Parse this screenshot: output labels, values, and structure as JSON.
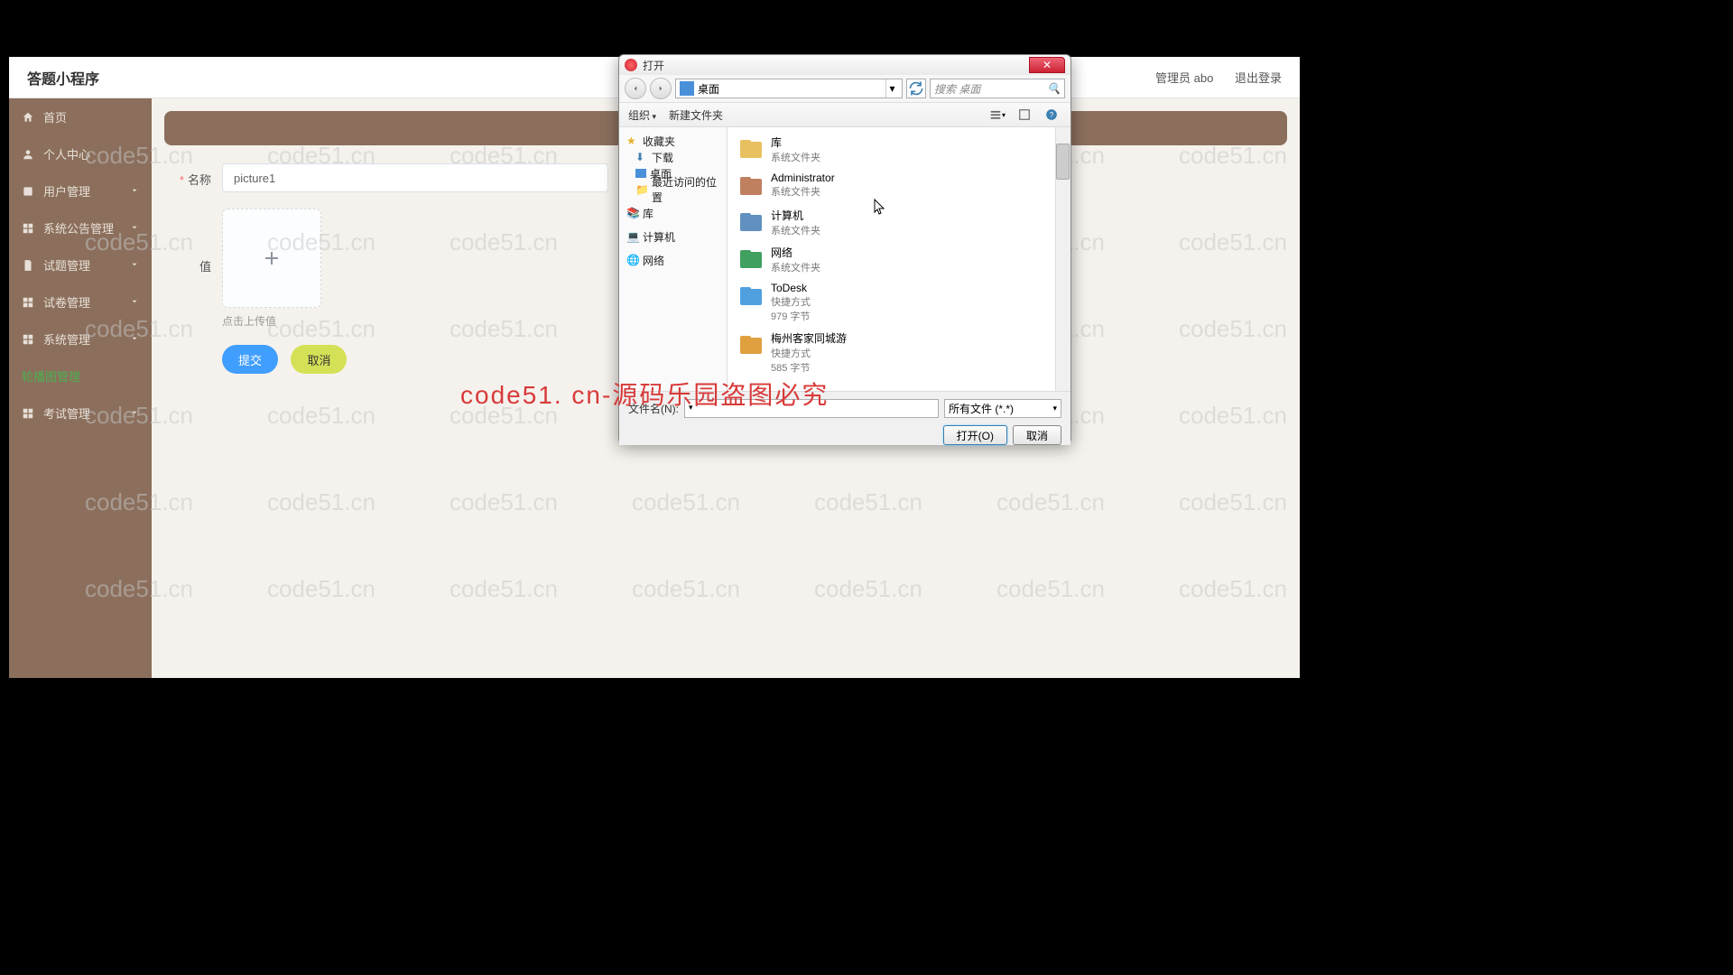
{
  "app": {
    "title": "答题小程序"
  },
  "header": {
    "admin": "管理员 abo",
    "logout": "退出登录"
  },
  "sidebar": {
    "items": [
      {
        "label": "首页",
        "icon": "home"
      },
      {
        "label": "个人中心",
        "icon": "user"
      },
      {
        "label": "用户管理",
        "icon": "users",
        "chevron": true
      },
      {
        "label": "系统公告管理",
        "icon": "grid",
        "chevron": true
      },
      {
        "label": "试题管理",
        "icon": "doc",
        "chevron": true
      },
      {
        "label": "试卷管理",
        "icon": "grid",
        "chevron": true
      },
      {
        "label": "系统管理",
        "icon": "grid",
        "chevron": true
      },
      {
        "label": "轮播图管理",
        "icon": "",
        "active": true
      },
      {
        "label": "考试管理",
        "icon": "grid",
        "chevron": true
      }
    ]
  },
  "form": {
    "name_label": "名称",
    "name_value": "picture1",
    "value_label": "值",
    "upload_hint": "点击上传值",
    "submit": "提交",
    "cancel": "取消"
  },
  "dialog": {
    "title": "打开",
    "path": "桌面",
    "search_placeholder": "搜索 桌面",
    "toolbar": {
      "organize": "组织",
      "newfolder": "新建文件夹"
    },
    "tree": {
      "fav": "收藏夹",
      "downloads": "下载",
      "desktop": "桌面",
      "recent": "最近访问的位置",
      "libraries": "库",
      "computer": "计算机",
      "network": "网络"
    },
    "files": [
      {
        "name": "库",
        "sub": "系统文件夹",
        "color": "#e8c060"
      },
      {
        "name": "Administrator",
        "sub": "系统文件夹",
        "color": "#c08060"
      },
      {
        "name": "计算机",
        "sub": "系统文件夹",
        "color": "#6090c0"
      },
      {
        "name": "网络",
        "sub": "系统文件夹",
        "color": "#40a060"
      },
      {
        "name": "ToDesk",
        "sub": "快捷方式",
        "sub2": "979 字节",
        "color": "#50a0e0"
      },
      {
        "name": "梅州客家同城游",
        "sub": "快捷方式",
        "sub2": "585 字节",
        "color": "#e0a040"
      }
    ],
    "filename_label": "文件名(N):",
    "filetype": "所有文件 (*.*)",
    "open": "打开(O)",
    "cancel": "取消"
  },
  "watermark": "code51.cn",
  "red_overlay": "code51. cn-源码乐园盗图必究"
}
